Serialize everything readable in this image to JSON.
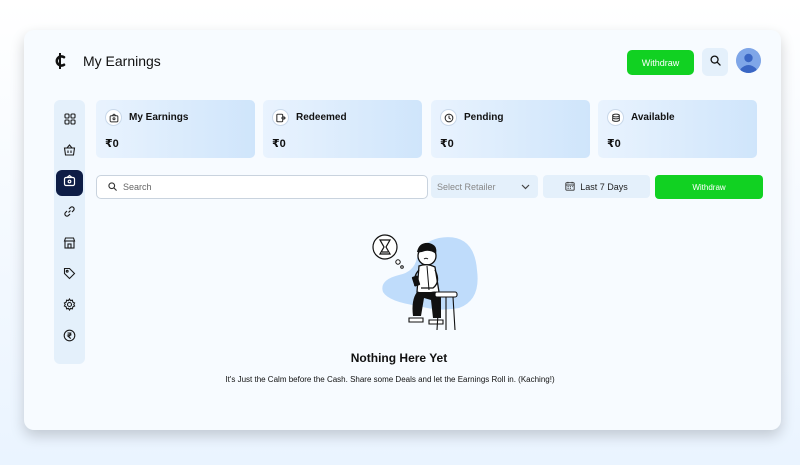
{
  "header": {
    "logo_icon": "cent-icon",
    "title": "My Earnings",
    "withdraw_label": "Withdraw",
    "search_icon": "search-icon",
    "avatar_icon": "user-avatar"
  },
  "sidebar": {
    "items": [
      {
        "name": "dashboard",
        "icon": "grid-icon",
        "active": false
      },
      {
        "name": "retailers",
        "icon": "basket-icon",
        "active": false
      },
      {
        "name": "earnings",
        "icon": "wallet-icon",
        "active": true
      },
      {
        "name": "links",
        "icon": "link-icon",
        "active": false
      },
      {
        "name": "stores",
        "icon": "store-icon",
        "active": false
      },
      {
        "name": "deals",
        "icon": "tag-icon",
        "active": false
      },
      {
        "name": "settings",
        "icon": "gear-icon",
        "active": false
      },
      {
        "name": "payments",
        "icon": "rupee-icon",
        "active": false
      }
    ]
  },
  "stats": [
    {
      "label": "My Earnings",
      "value": "₹0",
      "icon": "wallet-icon"
    },
    {
      "label": "Redeemed",
      "value": "₹0",
      "icon": "redeem-icon"
    },
    {
      "label": "Pending",
      "value": "₹0",
      "icon": "clock-icon"
    },
    {
      "label": "Available",
      "value": "₹0",
      "icon": "coins-icon"
    }
  ],
  "filters": {
    "search_placeholder": "Search",
    "retailer_placeholder": "Select Retailer",
    "date_label": "Last 7 Days",
    "withdraw_label": "Withdraw"
  },
  "empty_state": {
    "title": "Nothing Here Yet",
    "message": "It's Just the Calm before the Cash. Share some Deals and let the Earnings Roll in. (Kaching!)"
  },
  "colors": {
    "accent_green": "#11d122",
    "nav_active": "#0e1d46",
    "panel_bg": "#e4f0fb"
  }
}
